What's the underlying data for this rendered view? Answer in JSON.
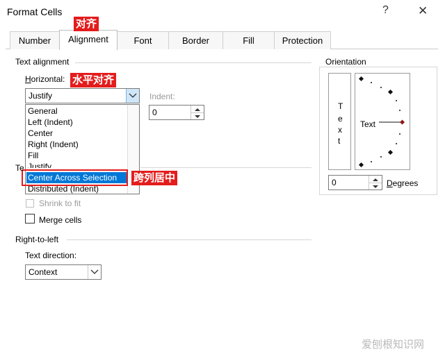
{
  "window": {
    "title": "Format Cells",
    "help": "?",
    "close": "✕"
  },
  "tabs": [
    {
      "label": "Number"
    },
    {
      "label": "Alignment"
    },
    {
      "label": "Font"
    },
    {
      "label": "Border"
    },
    {
      "label": "Fill"
    },
    {
      "label": "Protection"
    }
  ],
  "annotations": {
    "alignment_tab": "对齐",
    "horizontal": "水平对齐",
    "center_across": "跨列居中"
  },
  "text_alignment": {
    "title": "Text alignment",
    "horizontal_label": "Horizontal:",
    "horizontal_value": "Justify",
    "indent_label": "Indent:",
    "indent_value": "0",
    "options": [
      "General",
      "Left (Indent)",
      "Center",
      "Right (Indent)",
      "Fill",
      "Justify",
      "Center Across Selection",
      "Distributed (Indent)"
    ],
    "selected_option": "Center Across Selection"
  },
  "text_control": {
    "title_fragment": "Te",
    "shrink_label": "Shrink to fit",
    "merge_label": "Merge cells"
  },
  "rtl": {
    "title": "Right-to-left",
    "direction_label": "Text direction:",
    "direction_value": "Context"
  },
  "orientation": {
    "title": "Orientation",
    "vertical_text": [
      "T",
      "e",
      "x",
      "t"
    ],
    "dial_text": "Text",
    "degrees_value": "0",
    "degrees_label": "Degrees"
  },
  "watermark": "爱刨根知识网",
  "colors": {
    "accent": "#0078d7",
    "annotation_red": "#e41c1c",
    "dial_marker": "#8b1a1a"
  },
  "icons": {
    "dropdown": "chevron-down-icon",
    "spin_up": "triangle-up-icon",
    "spin_down": "triangle-down-icon"
  }
}
